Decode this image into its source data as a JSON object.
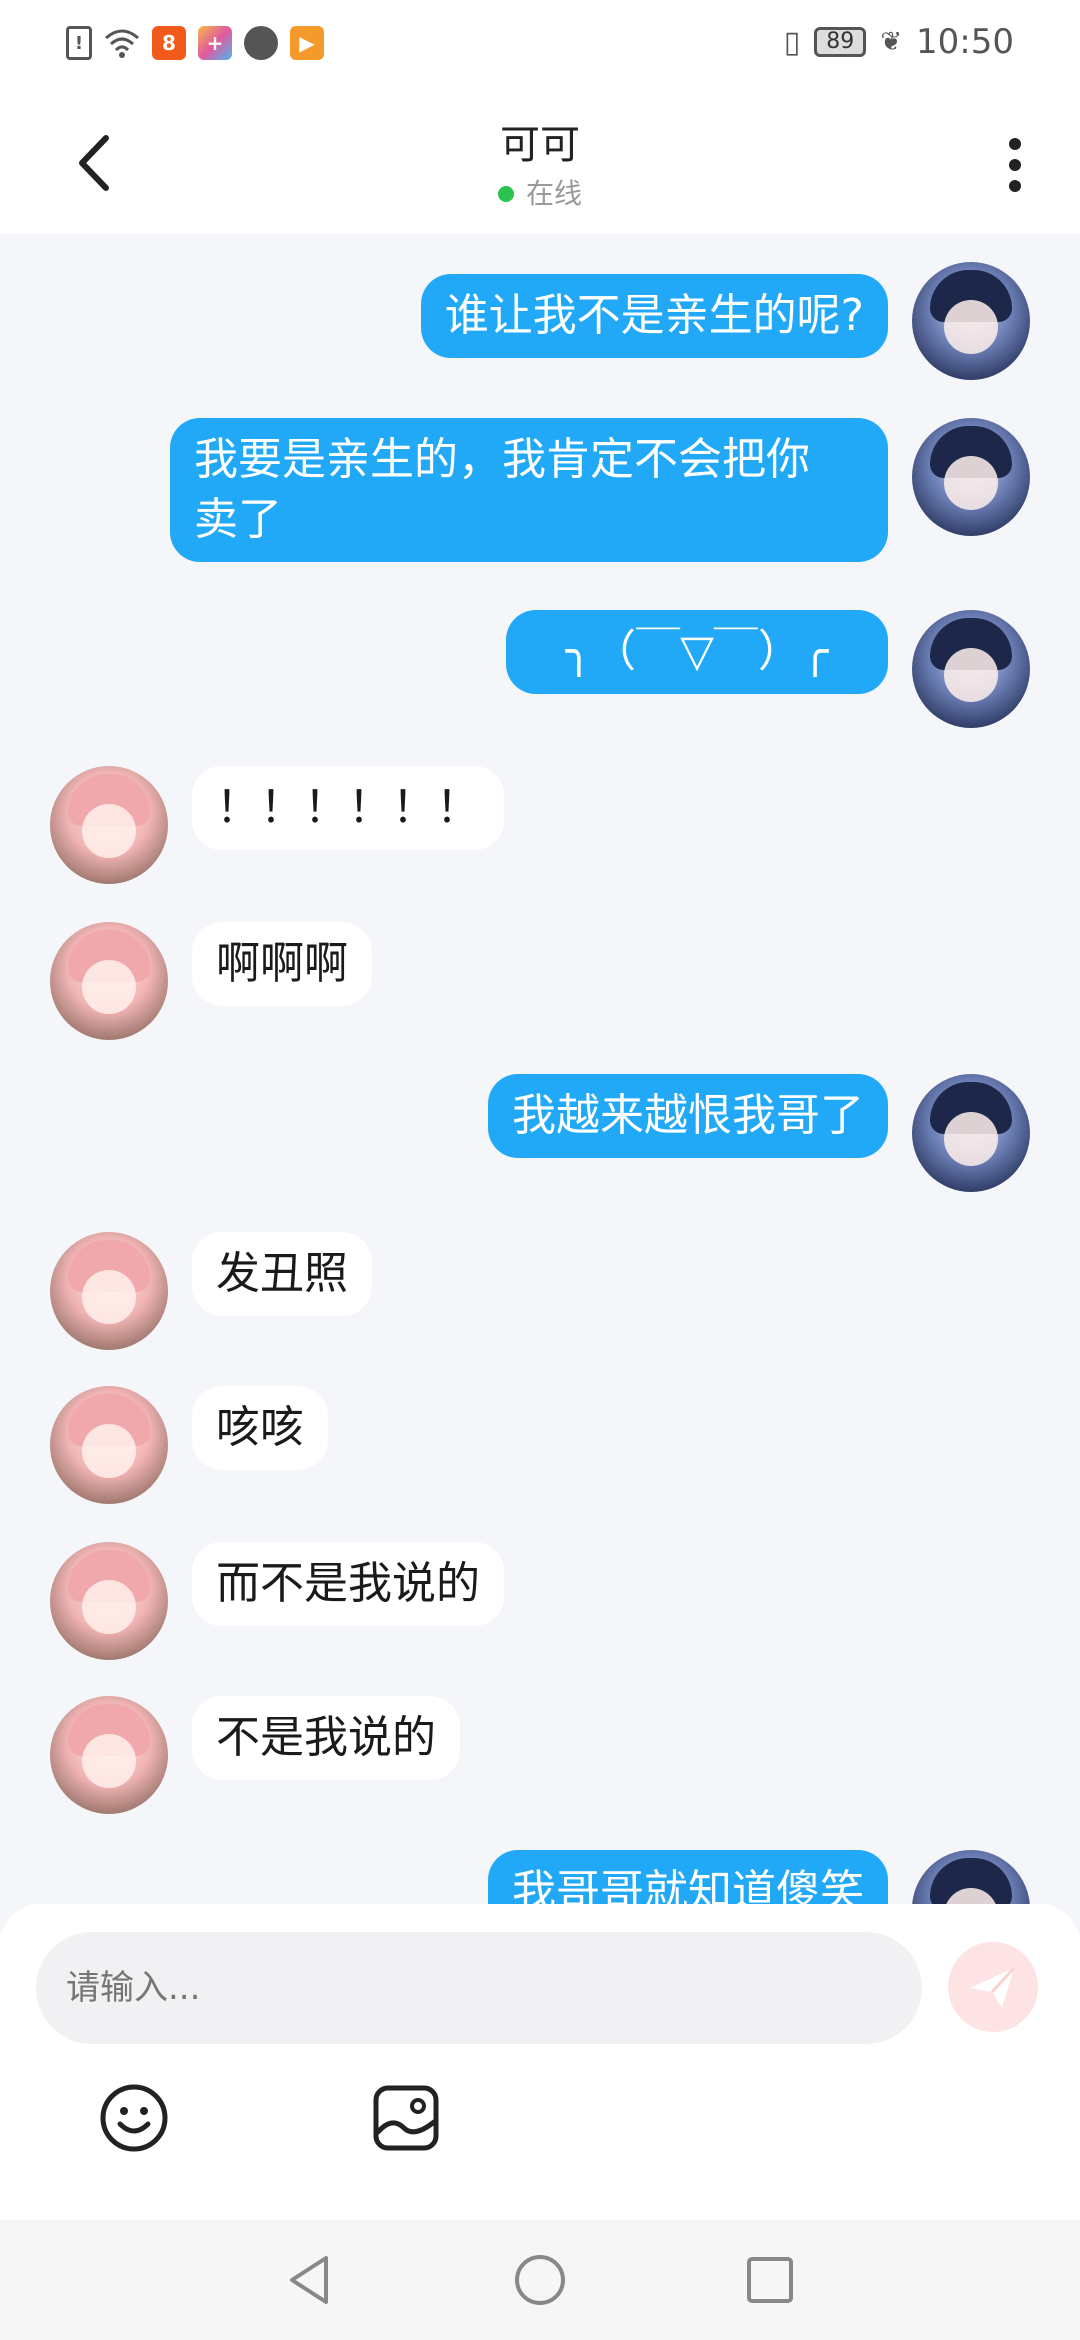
{
  "status_bar": {
    "battery": "89",
    "time": "10:50"
  },
  "header": {
    "title": "可可",
    "status": "在线"
  },
  "messages": [
    {
      "side": "self",
      "text": "谁让我不是亲生的呢?"
    },
    {
      "side": "self",
      "text": "我要是亲生的，我肯定不会把你\n卖了"
    },
    {
      "side": "self",
      "text": "╮（￣▽￣）╭"
    },
    {
      "side": "other",
      "text": "！！！！！！"
    },
    {
      "side": "other",
      "text": "啊啊啊"
    },
    {
      "side": "self",
      "text": "我越来越恨我哥了"
    },
    {
      "side": "other",
      "text": "发丑照"
    },
    {
      "side": "other",
      "text": "咳咳"
    },
    {
      "side": "other",
      "text": "而不是我说的"
    },
    {
      "side": "other",
      "text": "不是我说的"
    },
    {
      "side": "self",
      "text": "我哥哥就知道傻笑"
    }
  ],
  "composer": {
    "placeholder": "请输入..."
  },
  "icons": {
    "back": "back-arrow-icon",
    "more": "more-vertical-icon",
    "send": "send-plane-icon",
    "emoji": "smiley-icon",
    "image": "image-icon",
    "nav_back": "triangle-back-icon",
    "nav_home": "circle-home-icon",
    "nav_recent": "square-recent-icon"
  },
  "colors": {
    "self_bubble": "#21a8f6",
    "other_bubble": "#ffffff",
    "online_dot": "#2bc24f",
    "chat_bg": "#f4f6f9"
  }
}
